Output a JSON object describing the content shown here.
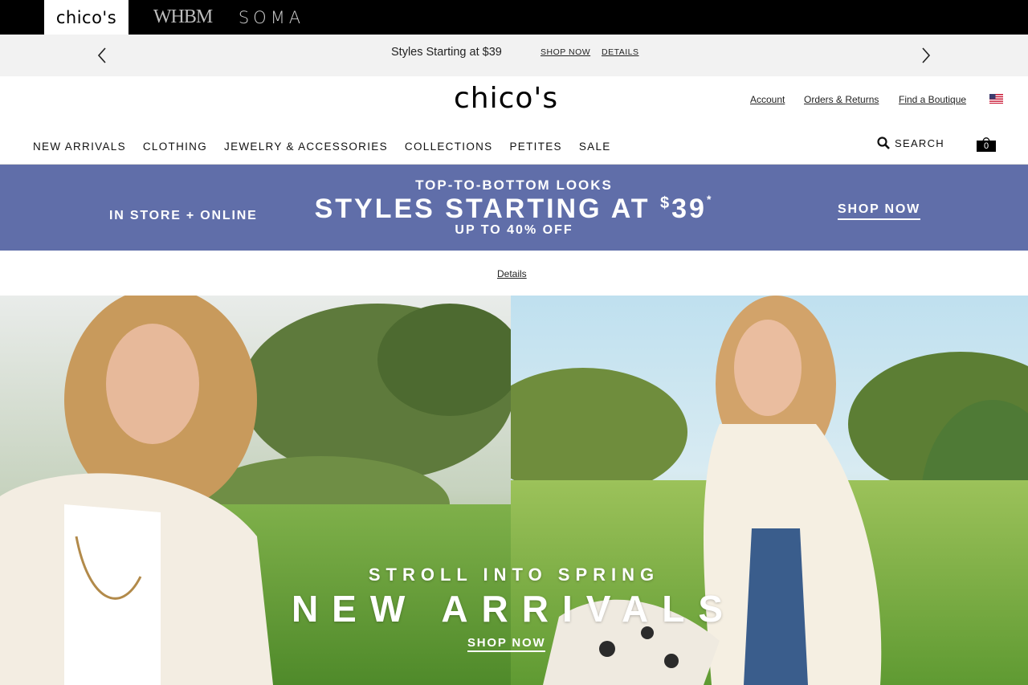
{
  "brands": {
    "chicos": "chico's",
    "whbm": "WHBM",
    "soma": "SOMA"
  },
  "promo_strip": {
    "text": "Styles Starting at $39",
    "shop_now": "SHOP NOW",
    "details": "DETAILS",
    "prev_icon": "chevron-left-icon",
    "next_icon": "chevron-right-icon"
  },
  "header": {
    "logo": "chico's",
    "account": "Account",
    "orders_returns": "Orders & Returns",
    "find_boutique": "Find a Boutique",
    "flag_icon": "us-flag-icon"
  },
  "nav": {
    "items": [
      "NEW ARRIVALS",
      "CLOTHING",
      "JEWELRY & ACCESSORIES",
      "COLLECTIONS",
      "PETITES",
      "SALE"
    ],
    "search_label": "SEARCH",
    "search_icon": "search-icon",
    "bag_icon": "shopping-bag-icon",
    "bag_count": "0"
  },
  "banner": {
    "background": "#606ea9",
    "left_text": "IN STORE + ONLINE",
    "eyebrow": "TOP-TO-BOTTOM LOOKS",
    "headline": "STYLES STARTING AT ",
    "price": "$39",
    "asterisk": "*",
    "sub": "UP TO 40% OFF",
    "cta": "SHOP NOW"
  },
  "details_link": "Details",
  "hero": {
    "eyebrow": "STROLL INTO SPRING",
    "headline": "NEW ARRIVALS",
    "cta": "SHOP NOW"
  }
}
